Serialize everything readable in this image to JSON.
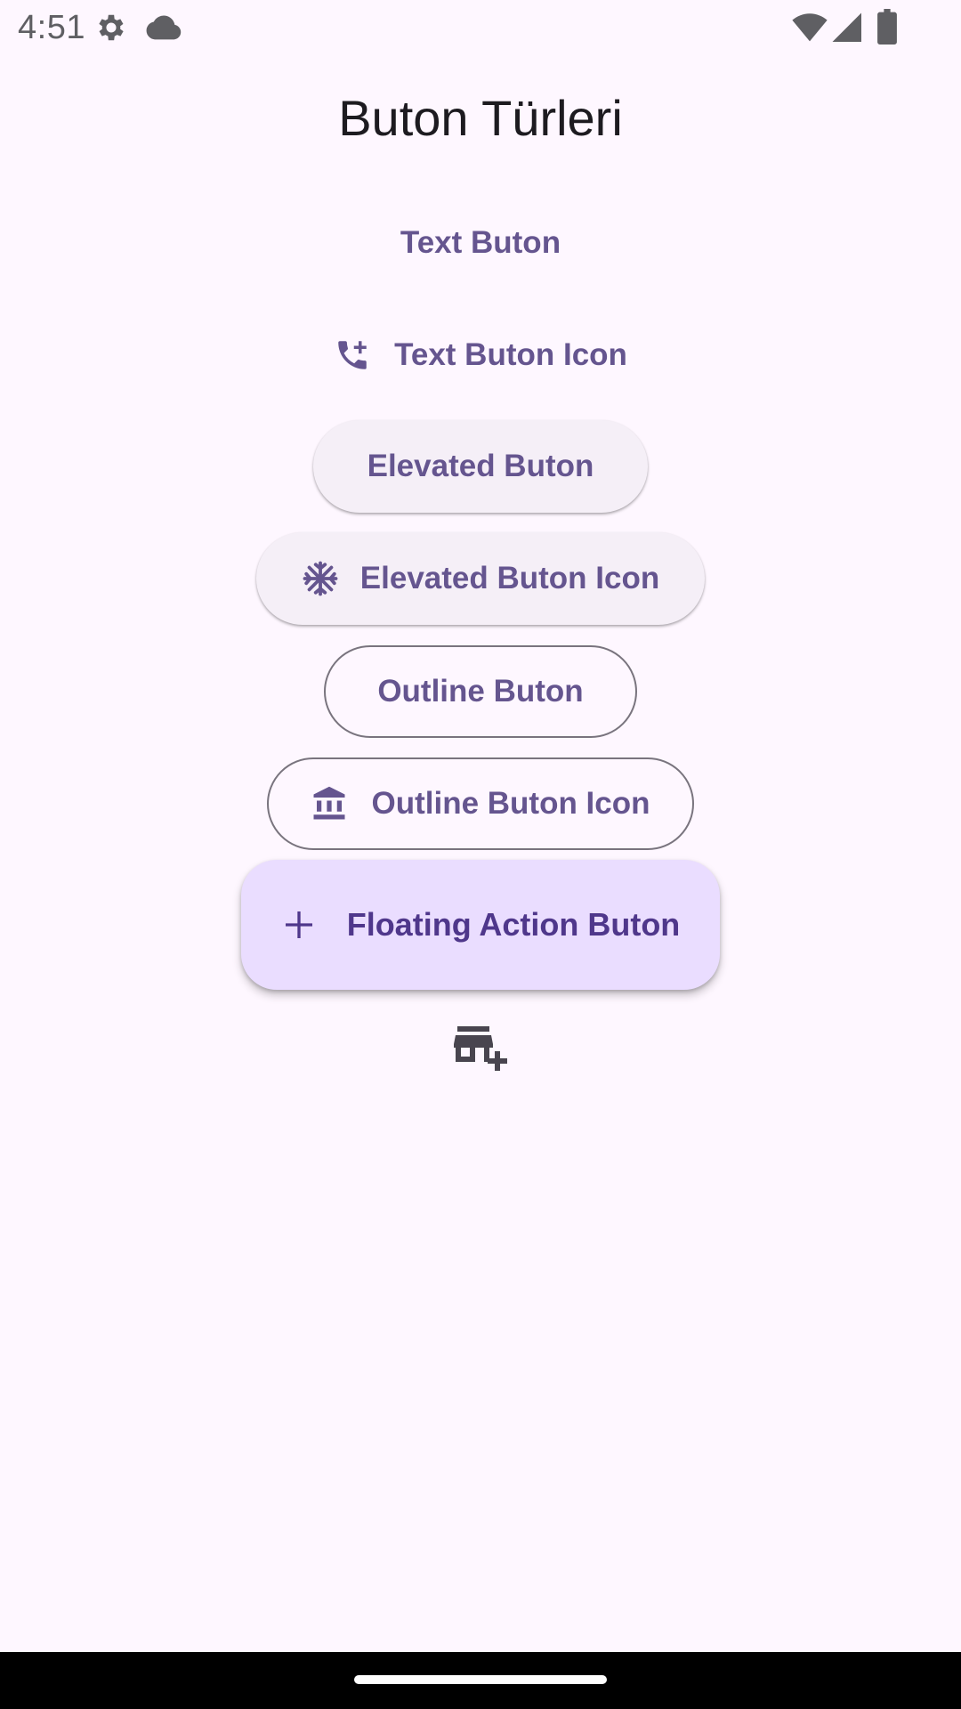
{
  "status_bar": {
    "time": "4:51",
    "icons": [
      "settings-gear-icon",
      "cloud-icon",
      "wifi-icon",
      "cell-signal-icon",
      "battery-icon"
    ]
  },
  "page": {
    "title": "Buton Türleri"
  },
  "buttons": {
    "text_button": "Text Buton",
    "text_button_icon": {
      "label": "Text Buton Icon",
      "icon": "add-call-icon"
    },
    "elevated_button": "Elevated Buton",
    "elevated_button_icon": {
      "label": "Elevated Buton Icon",
      "icon": "snowflake-icon"
    },
    "outline_button": "Outline Buton",
    "outline_button_icon": {
      "label": "Outline Buton Icon",
      "icon": "bank-icon"
    },
    "fab": {
      "label": "Floating Action Buton",
      "icon": "plus-icon"
    },
    "icon_button": {
      "icon": "add-business-icon"
    }
  },
  "colors": {
    "background": "#FEF7FF",
    "primary": "#65558F",
    "fab_background": "#EADDFF",
    "fab_foreground": "#4F378B",
    "elevated_background": "#F5EFF7",
    "outline": "#79747E",
    "title": "#1D1B20"
  }
}
